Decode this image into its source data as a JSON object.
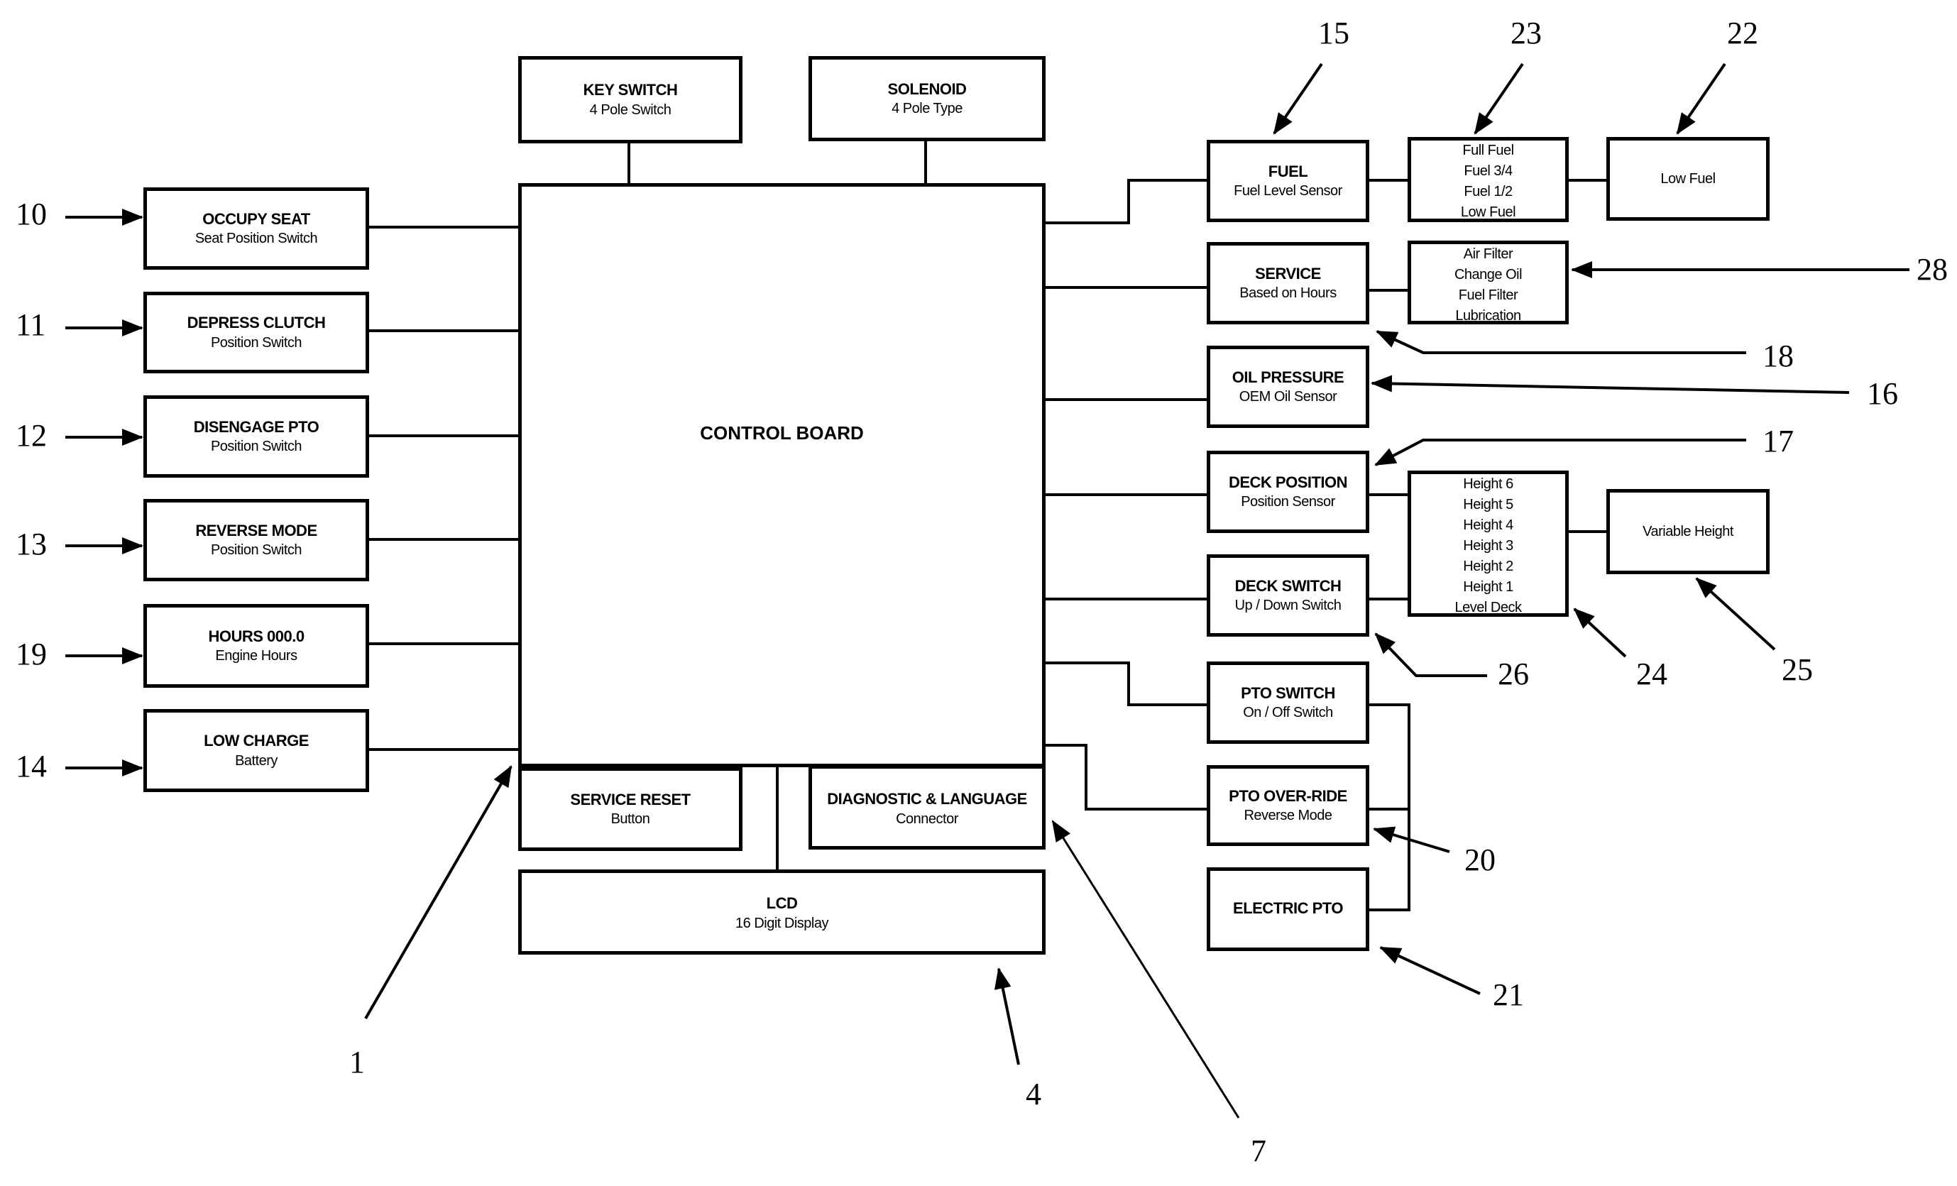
{
  "diagram": {
    "control_board": {
      "title": "CONTROL BOARD"
    },
    "top": {
      "key_switch": {
        "title": "KEY SWITCH",
        "subtitle": "4 Pole Switch"
      },
      "solenoid": {
        "title": "SOLENOID",
        "subtitle": "4 Pole Type"
      }
    },
    "inputs": [
      {
        "ref": "10",
        "title": "OCCUPY SEAT",
        "subtitle": "Seat Position Switch"
      },
      {
        "ref": "11",
        "title": "DEPRESS CLUTCH",
        "subtitle": "Position Switch"
      },
      {
        "ref": "12",
        "title": "DISENGAGE PTO",
        "subtitle": "Position Switch"
      },
      {
        "ref": "13",
        "title": "REVERSE MODE",
        "subtitle": "Position Switch"
      },
      {
        "ref": "19",
        "title": "HOURS 000.0",
        "subtitle": "Engine Hours"
      },
      {
        "ref": "14",
        "title": "LOW CHARGE",
        "subtitle": "Battery"
      }
    ],
    "bottom": {
      "service_reset": {
        "title": "SERVICE RESET",
        "subtitle": "Button"
      },
      "diagnostic": {
        "title": "DIAGNOSTIC & LANGUAGE",
        "subtitle": "Connector"
      },
      "lcd": {
        "title": "LCD",
        "subtitle": "16 Digit Display"
      }
    },
    "outputs": {
      "fuel": {
        "title": "FUEL",
        "subtitle": "Fuel Level Sensor"
      },
      "service": {
        "title": "SERVICE",
        "subtitle": "Based on Hours"
      },
      "oil_pressure": {
        "title": "OIL PRESSURE",
        "subtitle": "OEM Oil Sensor"
      },
      "deck_position": {
        "title": "DECK POSITION",
        "subtitle": "Position Sensor"
      },
      "deck_switch": {
        "title": "DECK SWITCH",
        "subtitle": "Up / Down Switch"
      },
      "pto_switch": {
        "title": "PTO SWITCH",
        "subtitle": "On / Off Switch"
      },
      "pto_override": {
        "title": "PTO OVER-RIDE",
        "subtitle": "Reverse Mode"
      },
      "electric_pto": {
        "title": "ELECTRIC PTO"
      }
    },
    "fuel_levels": [
      "Full Fuel",
      "Fuel 3/4",
      "Fuel 1/2",
      "Low Fuel"
    ],
    "low_fuel": "Low Fuel",
    "service_items": [
      "Air Filter",
      "Change Oil",
      "Fuel Filter",
      "Lubrication"
    ],
    "heights": [
      "Height 6",
      "Height 5",
      "Height 4",
      "Height 3",
      "Height 2",
      "Height 1",
      "Level Deck"
    ],
    "variable_height": "Variable Height",
    "refs": {
      "r1": "1",
      "r4": "4",
      "r7": "7",
      "r15": "15",
      "r16": "16",
      "r17": "17",
      "r18": "18",
      "r20": "20",
      "r21": "21",
      "r22": "22",
      "r23": "23",
      "r24": "24",
      "r25": "25",
      "r26": "26",
      "r28": "28"
    }
  }
}
